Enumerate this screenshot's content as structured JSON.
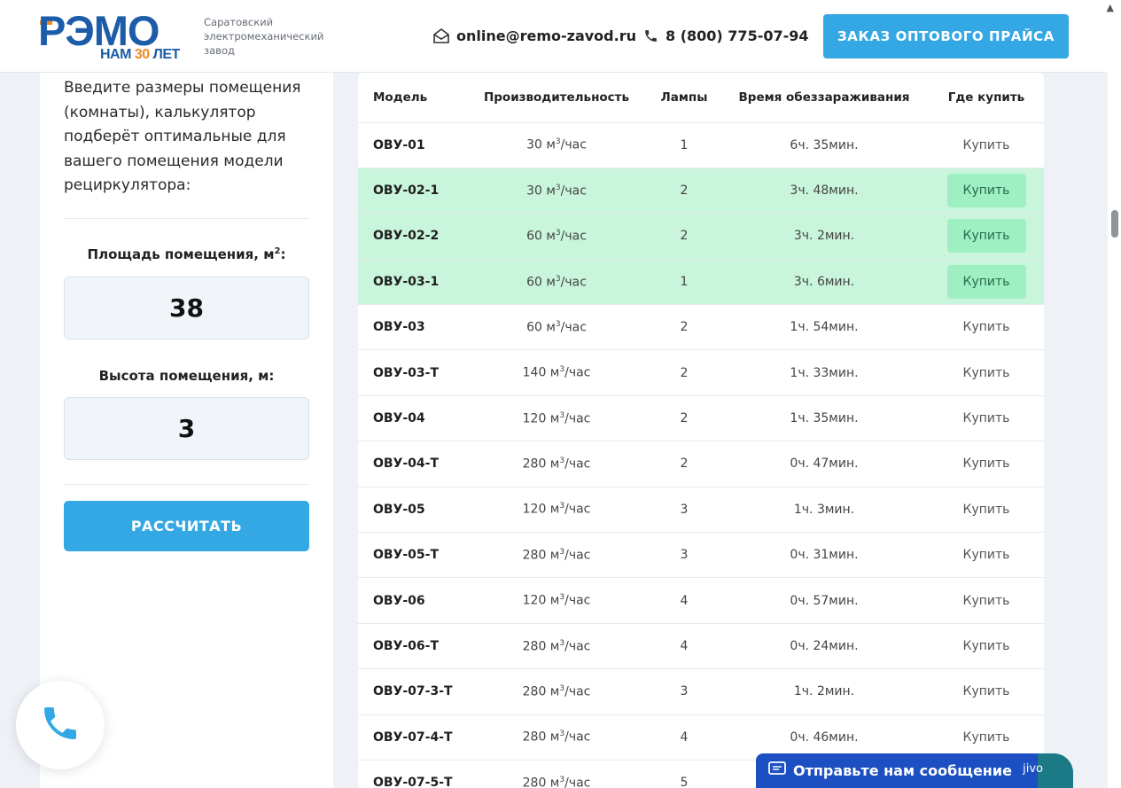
{
  "header": {
    "logo_main": "РЭМО",
    "logo_sub_prefix": "НАМ ",
    "logo_sub_num": "30",
    "logo_sub_suffix": " ЛЕТ",
    "tagline": "Саратовский электромеханический завод",
    "email": "online@remo-zavod.ru",
    "phone": "8 (800) 775-07-94",
    "cta_label": "ЗАКАЗ ОПТОВОГО ПРАЙСА",
    "icons": [
      "envelope-icon",
      "phone-icon"
    ]
  },
  "calculator": {
    "intro": "Введите размеры помещения (комнаты), калькулятор подберёт оптимальные для вашего помещения модели рециркулятора:",
    "area_label": "Площадь помещения, м",
    "area_label_sup": "2",
    "area_label_tail": ":",
    "area_value": "38",
    "height_label": "Высота помещения, м:",
    "height_value": "3",
    "button_label": "РАССЧИТАТЬ"
  },
  "table": {
    "columns": [
      "Модель",
      "Производительность",
      "Лампы",
      "Время обеззараживания",
      "Где купить"
    ],
    "unit_prefix": " м",
    "unit_sup": "3",
    "unit_suffix": "/час",
    "rows": [
      {
        "model": "ОВУ-01",
        "capacity": "30",
        "lamps": "1",
        "time": "6ч. 35мин.",
        "buy": "Купить",
        "highlight": false
      },
      {
        "model": "ОВУ-02-1",
        "capacity": "30",
        "lamps": "2",
        "time": "3ч. 48мин.",
        "buy": "Купить",
        "highlight": true
      },
      {
        "model": "ОВУ-02-2",
        "capacity": "60",
        "lamps": "2",
        "time": "3ч. 2мин.",
        "buy": "Купить",
        "highlight": true
      },
      {
        "model": "ОВУ-03-1",
        "capacity": "60",
        "lamps": "1",
        "time": "3ч. 6мин.",
        "buy": "Купить",
        "highlight": true
      },
      {
        "model": "ОВУ-03",
        "capacity": "60",
        "lamps": "2",
        "time": "1ч. 54мин.",
        "buy": "Купить",
        "highlight": false
      },
      {
        "model": "ОВУ-03-Т",
        "capacity": "140",
        "lamps": "2",
        "time": "1ч. 33мин.",
        "buy": "Купить",
        "highlight": false
      },
      {
        "model": "ОВУ-04",
        "capacity": "120",
        "lamps": "2",
        "time": "1ч. 35мин.",
        "buy": "Купить",
        "highlight": false
      },
      {
        "model": "ОВУ-04-Т",
        "capacity": "280",
        "lamps": "2",
        "time": "0ч. 47мин.",
        "buy": "Купить",
        "highlight": false
      },
      {
        "model": "ОВУ-05",
        "capacity": "120",
        "lamps": "3",
        "time": "1ч. 3мин.",
        "buy": "Купить",
        "highlight": false
      },
      {
        "model": "ОВУ-05-Т",
        "capacity": "280",
        "lamps": "3",
        "time": "0ч. 31мин.",
        "buy": "Купить",
        "highlight": false
      },
      {
        "model": "ОВУ-06",
        "capacity": "120",
        "lamps": "4",
        "time": "0ч. 57мин.",
        "buy": "Купить",
        "highlight": false
      },
      {
        "model": "ОВУ-06-Т",
        "capacity": "280",
        "lamps": "4",
        "time": "0ч. 24мин.",
        "buy": "Купить",
        "highlight": false
      },
      {
        "model": "ОВУ-07-3-Т",
        "capacity": "280",
        "lamps": "3",
        "time": "1ч. 2мин.",
        "buy": "Купить",
        "highlight": false
      },
      {
        "model": "ОВУ-07-4-Т",
        "capacity": "280",
        "lamps": "4",
        "time": "0ч. 46мин.",
        "buy": "Купить",
        "highlight": false
      },
      {
        "model": "ОВУ-07-5-Т",
        "capacity": "280",
        "lamps": "5",
        "time": "",
        "buy": "",
        "highlight": false
      }
    ]
  },
  "chat": {
    "label": "Отправьте нам сообщение",
    "brand": "jivo"
  },
  "colors": {
    "accent": "#34a8e4",
    "brand_blue": "#1c5ca8",
    "brand_orange": "#f08a24",
    "highlight_row": "#c9f5dc",
    "highlight_button": "#9ef0c2",
    "chat_bg": "#1b4fc2"
  }
}
